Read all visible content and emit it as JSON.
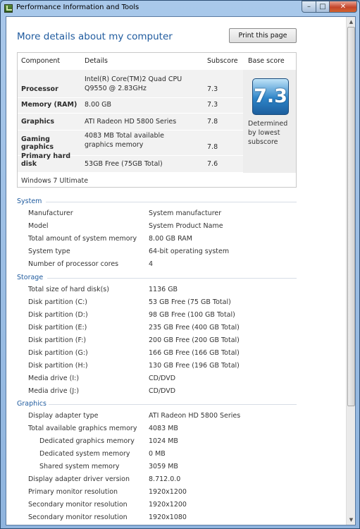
{
  "window": {
    "title": "Performance Information and Tools"
  },
  "page": {
    "title": "More details about my computer",
    "print_button": "Print this page"
  },
  "score_table": {
    "headers": {
      "component": "Component",
      "details": "Details",
      "subscore": "Subscore",
      "base_score": "Base score"
    },
    "rows": [
      {
        "component": "Processor",
        "details": "Intel(R) Core(TM)2 Quad CPU Q9550 @ 2.83GHz",
        "subscore": "7.3"
      },
      {
        "component": "Memory (RAM)",
        "details": "8.00 GB",
        "subscore": "7.3"
      },
      {
        "component": "Graphics",
        "details": "ATI Radeon HD 5800 Series",
        "subscore": "7.8"
      },
      {
        "component": "Gaming graphics",
        "details": "4083 MB Total available graphics memory",
        "subscore": "7.8"
      },
      {
        "component": "Primary hard disk",
        "details": "53GB Free (75GB Total)",
        "subscore": "7.6"
      }
    ],
    "base_score": "7.3",
    "base_note": "Determined by lowest subscore",
    "edition": "Windows 7 Ultimate"
  },
  "system": {
    "heading": "System",
    "rows": [
      {
        "label": "Manufacturer",
        "value": "System manufacturer"
      },
      {
        "label": "Model",
        "value": "System Product Name"
      },
      {
        "label": "Total amount of system memory",
        "value": "8.00 GB RAM"
      },
      {
        "label": "System type",
        "value": "64-bit operating system"
      },
      {
        "label": "Number of processor cores",
        "value": "4"
      }
    ]
  },
  "storage": {
    "heading": "Storage",
    "rows": [
      {
        "label": "Total size of hard disk(s)",
        "value": "1136 GB"
      },
      {
        "label": "Disk partition (C:)",
        "value": "53 GB Free (75 GB Total)"
      },
      {
        "label": "Disk partition (D:)",
        "value": "98 GB Free (100 GB Total)"
      },
      {
        "label": "Disk partition (E:)",
        "value": "235 GB Free (400 GB Total)"
      },
      {
        "label": "Disk partition (F:)",
        "value": "200 GB Free (200 GB Total)"
      },
      {
        "label": "Disk partition (G:)",
        "value": "166 GB Free (166 GB Total)"
      },
      {
        "label": "Disk partition (H:)",
        "value": "130 GB Free (196 GB Total)"
      },
      {
        "label": "Media drive (I:)",
        "value": "CD/DVD"
      },
      {
        "label": "Media drive (J:)",
        "value": "CD/DVD"
      }
    ]
  },
  "graphics": {
    "heading": "Graphics",
    "rows": [
      {
        "label": "Display adapter type",
        "value": "ATI Radeon HD 5800 Series"
      },
      {
        "label": "Total available graphics memory",
        "value": "4083 MB"
      },
      {
        "label": "Dedicated graphics memory",
        "value": "1024 MB"
      },
      {
        "label": "Dedicated system memory",
        "value": "0 MB"
      },
      {
        "label": "Shared system memory",
        "value": "3059 MB"
      },
      {
        "label": "Display adapter driver version",
        "value": "8.712.0.0"
      },
      {
        "label": "Primary monitor resolution",
        "value": "1920x1200"
      },
      {
        "label": "Secondary monitor resolution",
        "value": "1920x1200"
      },
      {
        "label": "Secondary monitor resolution",
        "value": "1920x1080"
      }
    ]
  }
}
